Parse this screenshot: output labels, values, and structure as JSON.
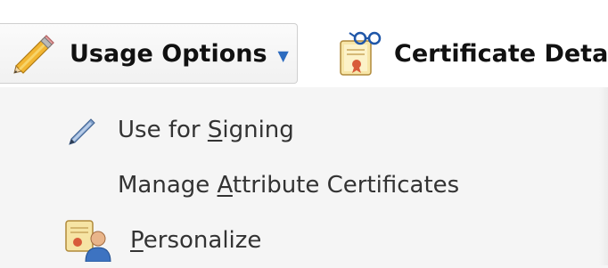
{
  "toolbar": {
    "usage_options": {
      "icon": "pencil-icon",
      "label": "Usage Options",
      "dropdown_icon": "chevron-down-icon"
    },
    "certificate_details": {
      "icon": "certificate-glasses-icon",
      "label": "Certificate Deta"
    }
  },
  "menu": {
    "items": [
      {
        "icon": "pen-icon",
        "prefix": "Use for ",
        "mnemonic": "S",
        "suffix": "igning"
      },
      {
        "icon": null,
        "prefix": "Manage ",
        "mnemonic": "A",
        "suffix": "ttribute Certificates"
      },
      {
        "icon": "personalize-icon",
        "prefix": "",
        "mnemonic": "P",
        "suffix": "ersonalize"
      }
    ]
  },
  "colors": {
    "accent": "#2c6bbf",
    "menu_background": "#f5f5f5",
    "toolbar_background": "#ffffff"
  }
}
